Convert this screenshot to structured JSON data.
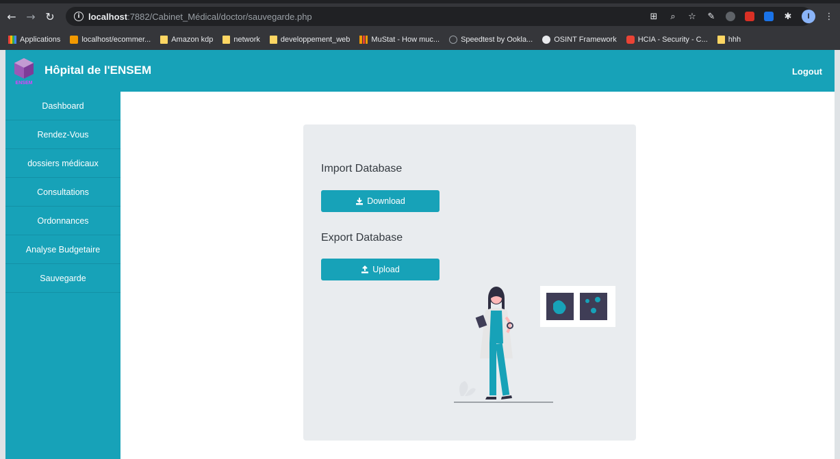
{
  "browser": {
    "url_host": "localhost",
    "url_path": ":7882/Cabinet_Médical/doctor/sauvegarde.php",
    "profile_initial": "I",
    "bookmarks": [
      {
        "label": "Applications",
        "icon": "apps-icon"
      },
      {
        "label": "localhost/ecommer...",
        "icon": "site-favicon"
      },
      {
        "label": "Amazon kdp",
        "icon": "folder-icon"
      },
      {
        "label": "network",
        "icon": "folder-icon"
      },
      {
        "label": "developpement_web",
        "icon": "folder-icon"
      },
      {
        "label": "MuStat - How muc...",
        "icon": "chart-favicon"
      },
      {
        "label": "Speedtest by Ookla...",
        "icon": "speedtest-favicon"
      },
      {
        "label": "OSINT Framework",
        "icon": "globe-icon"
      },
      {
        "label": "HCIA - Security - C...",
        "icon": "youtube-icon"
      },
      {
        "label": "hhh",
        "icon": "folder-icon"
      }
    ]
  },
  "header": {
    "brand": "Hôpital de l'ENSEM",
    "logo_text": "ENSEM",
    "logout": "Logout"
  },
  "sidebar": {
    "items": [
      {
        "label": "Dashboard"
      },
      {
        "label": "Rendez-Vous"
      },
      {
        "label": "dossiers médicaux"
      },
      {
        "label": "Consultations"
      },
      {
        "label": "Ordonnances"
      },
      {
        "label": "Analyse Budgetaire"
      },
      {
        "label": "Sauvegarde"
      }
    ]
  },
  "main": {
    "import_title": "Import Database",
    "download_label": "Download",
    "export_title": "Export Database",
    "upload_label": "Upload"
  },
  "colors": {
    "accent": "#17a2b8",
    "card_bg": "#e9ecef"
  }
}
